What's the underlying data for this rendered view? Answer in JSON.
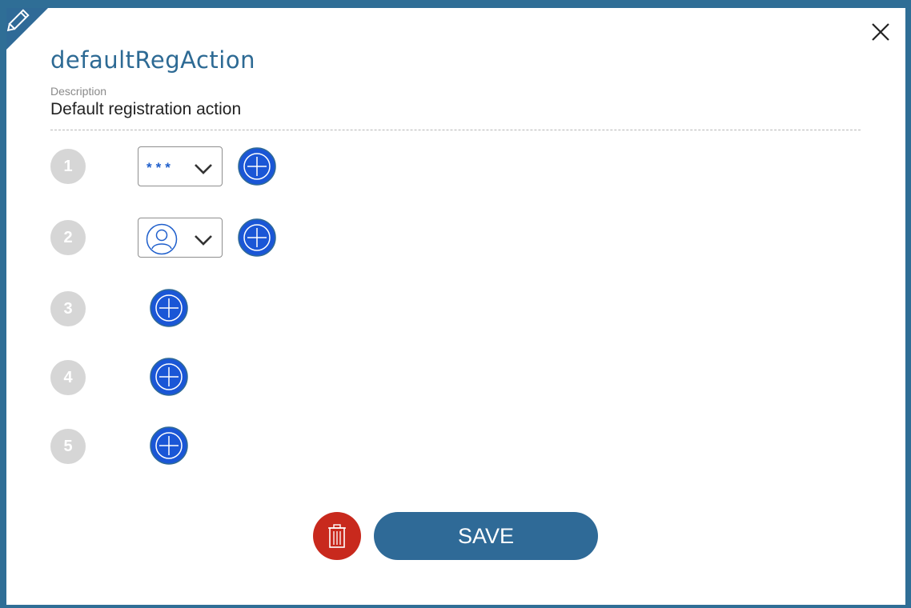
{
  "dialog": {
    "title": "defaultRegAction",
    "description_label": "Description",
    "description_value": "Default registration action"
  },
  "icons": {
    "edit": "pencil-icon",
    "close": "close-icon",
    "add": "plus-circle-icon",
    "chevron": "chevron-down-icon",
    "user": "user-icon",
    "delete": "trash-icon"
  },
  "steps": [
    {
      "number": "1",
      "selector": "password",
      "glyph": "***"
    },
    {
      "number": "2",
      "selector": "user"
    },
    {
      "number": "3"
    },
    {
      "number": "4"
    },
    {
      "number": "5"
    }
  ],
  "actions": {
    "save_label": "SAVE"
  },
  "colors": {
    "accent": "#2f6a97",
    "add_button": "#1a56d6",
    "delete": "#c8291d",
    "step_circle": "#d6d6d6"
  }
}
